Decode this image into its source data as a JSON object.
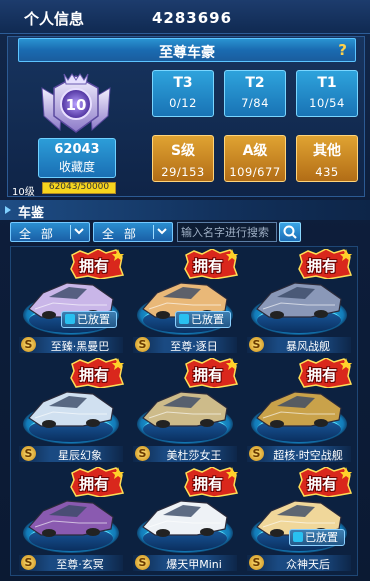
{
  "header": {
    "title": "个人信息",
    "player_id": "4283696"
  },
  "rank_bar": {
    "title": "至尊车豪",
    "help": "?"
  },
  "badge": {
    "level_number": "10",
    "collection_value": "62043",
    "collection_label": "收藏度"
  },
  "level": {
    "label": "10级",
    "progress_text": "62043/50000",
    "progress_fraction": 1.0
  },
  "tiers": [
    {
      "label": "T3",
      "count": "0/12"
    },
    {
      "label": "T2",
      "count": "7/84"
    },
    {
      "label": "T1",
      "count": "10/54"
    }
  ],
  "grades": [
    {
      "label": "S级",
      "count": "29/153"
    },
    {
      "label": "A级",
      "count": "109/677"
    },
    {
      "label": "其他",
      "count": "435"
    }
  ],
  "section": {
    "title": "车鉴"
  },
  "filters": [
    {
      "selected": "全 部"
    },
    {
      "selected": "全 部"
    }
  ],
  "search": {
    "placeholder": "输入名字进行搜索"
  },
  "cards": [
    {
      "name": "至臻·黑曼巴",
      "owned_label": "拥有",
      "placed_label": "已放置",
      "placed": true,
      "grade": "S",
      "color": "#c9b6e8"
    },
    {
      "name": "至尊·逐日",
      "owned_label": "拥有",
      "placed_label": "已放置",
      "placed": true,
      "grade": "S",
      "color": "#e9b878"
    },
    {
      "name": "暴风战舰",
      "owned_label": "拥有",
      "placed_label": "",
      "placed": false,
      "grade": "S",
      "color": "#8a98b8"
    },
    {
      "name": "星辰幻象",
      "owned_label": "拥有",
      "placed_label": "",
      "placed": false,
      "grade": "S",
      "color": "#d0e0f0"
    },
    {
      "name": "美杜莎女王",
      "owned_label": "拥有",
      "placed_label": "",
      "placed": false,
      "grade": "S",
      "color": "#cdbb8a"
    },
    {
      "name": "超核·时空战舰",
      "owned_label": "拥有",
      "placed_label": "",
      "placed": false,
      "grade": "S",
      "color": "#c9a24a"
    },
    {
      "name": "至尊·玄冥",
      "owned_label": "拥有",
      "placed_label": "",
      "placed": false,
      "grade": "S",
      "color": "#8a5ab0"
    },
    {
      "name": "爆天甲Mini",
      "owned_label": "拥有",
      "placed_label": "",
      "placed": false,
      "grade": "S",
      "color": "#eef2f6"
    },
    {
      "name": "众神天后",
      "owned_label": "拥有",
      "placed_label": "已放置",
      "placed": true,
      "grade": "S",
      "color": "#f0d79a"
    }
  ]
}
